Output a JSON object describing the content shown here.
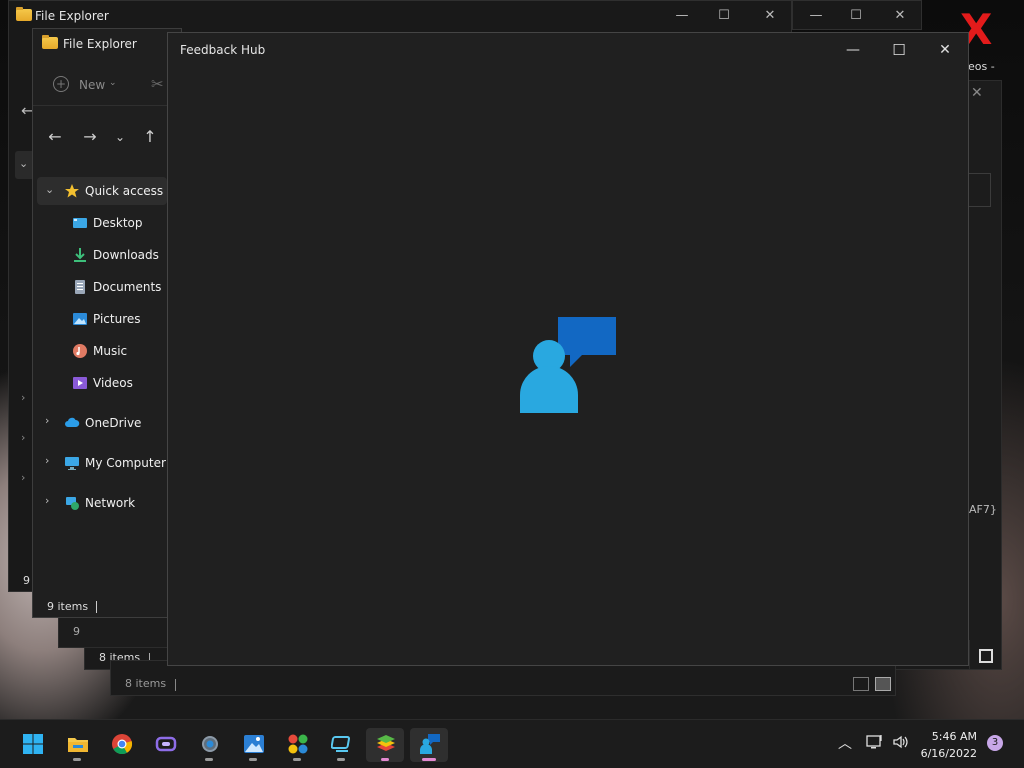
{
  "desktop": {
    "corner_label": "eos -"
  },
  "background_windows": {
    "explorer_back_title": "File Explorer",
    "explorer_back_status": "9 i",
    "explorer_third_status": "9",
    "status_8_items_a": "8 items",
    "status_8_items_b": "8 items",
    "guid_fragment": "AF7}"
  },
  "file_explorer": {
    "title": "File Explorer",
    "new_label": "New",
    "tree": [
      {
        "label": "Quick access",
        "icon": "star-icon",
        "expandable": true,
        "expanded": true,
        "selected": true
      },
      {
        "label": "Desktop",
        "icon": "desktop-icon"
      },
      {
        "label": "Downloads",
        "icon": "download-icon"
      },
      {
        "label": "Documents",
        "icon": "document-icon"
      },
      {
        "label": "Pictures",
        "icon": "pictures-icon"
      },
      {
        "label": "Music",
        "icon": "music-icon"
      },
      {
        "label": "Videos",
        "icon": "videos-icon"
      },
      {
        "label": "OneDrive",
        "icon": "cloud-icon",
        "expandable": true
      },
      {
        "label": "My Computer",
        "icon": "computer-icon",
        "expandable": true
      },
      {
        "label": "Network",
        "icon": "network-icon",
        "expandable": true
      }
    ],
    "status": "9 items"
  },
  "feedback_hub": {
    "title": "Feedback Hub",
    "splash_icon": "feedback-hub-logo-icon",
    "accent_color": "#29a8e0",
    "accent_dark": "#1268c3"
  },
  "taskbar": {
    "apps": [
      {
        "name": "start",
        "icon": "windows-logo-icon"
      },
      {
        "name": "file-explorer",
        "icon": "folder-icon",
        "running": true
      },
      {
        "name": "chrome",
        "icon": "chrome-icon"
      },
      {
        "name": "app-purple",
        "icon": "purple-app-icon"
      },
      {
        "name": "settings",
        "icon": "gear-icon",
        "running": true
      },
      {
        "name": "photos",
        "icon": "photos-icon",
        "running": true
      },
      {
        "name": "snip",
        "icon": "colorful-app-icon",
        "running": true
      },
      {
        "name": "app-cyan",
        "icon": "cyan-app-icon",
        "running": true
      },
      {
        "name": "bluestacks",
        "icon": "stack-icon",
        "running": true
      },
      {
        "name": "feedback-hub",
        "icon": "feedback-hub-icon",
        "running": true,
        "active": true
      }
    ],
    "time": "5:46 AM",
    "date": "6/16/2022",
    "notification_count": "3"
  }
}
